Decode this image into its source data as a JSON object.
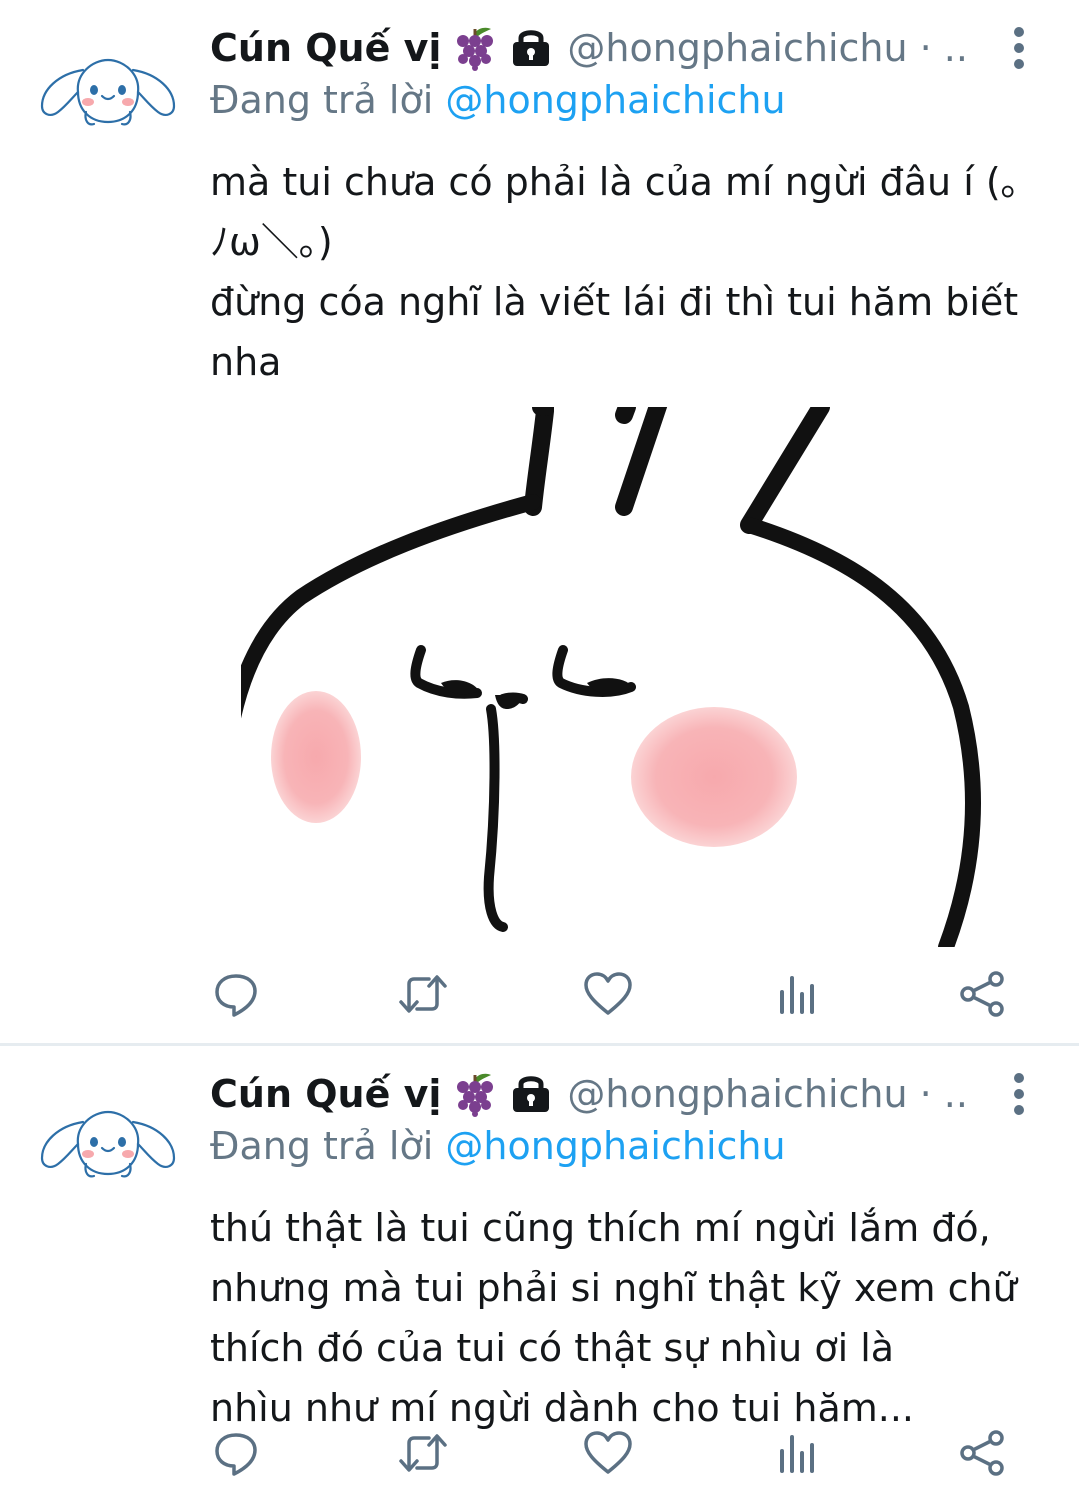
{
  "colors": {
    "text": "#14171a",
    "secondary": "#657786",
    "link": "#1da1f2",
    "icon": "#5b7083",
    "divider": "#e6ecf0",
    "blush": "#f7a9ad"
  },
  "tweets": [
    {
      "display_name": "Cún Quế vị",
      "emoji_icons": [
        "grapes-icon",
        "lock-icon"
      ],
      "handle": "@hongphaichichu · ...",
      "replying_prefix": "Đang trả lời",
      "replying_to": "@hongphaichichu",
      "body_lines": [
        "mà tui chưa có phải là của mí ngừi đâu í (｡",
        "ﾉω＼｡)",
        "đừng cóa nghĩ là viết lái đi thì tui hăm biết",
        "nha"
      ],
      "media": "bunny-face-sticker",
      "actions": [
        "reply-icon",
        "retweet-icon",
        "like-icon",
        "analytics-icon",
        "share-icon"
      ]
    },
    {
      "display_name": "Cún Quế vị",
      "emoji_icons": [
        "grapes-icon",
        "lock-icon"
      ],
      "handle": "@hongphaichichu · ...",
      "replying_prefix": "Đang trả lời",
      "replying_to": "@hongphaichichu",
      "body_lines": [
        "thú thật là tui cũng thích mí ngừi lắm đó,",
        "nhưng mà tui phải si nghĩ thật kỹ xem chữ",
        "thích đó của tui có thật sự nhìu ơi là",
        "nhìu như mí ngừi dành cho tui hăm..."
      ],
      "actions": [
        "reply-icon",
        "retweet-icon",
        "like-icon",
        "analytics-icon",
        "share-icon"
      ]
    }
  ]
}
